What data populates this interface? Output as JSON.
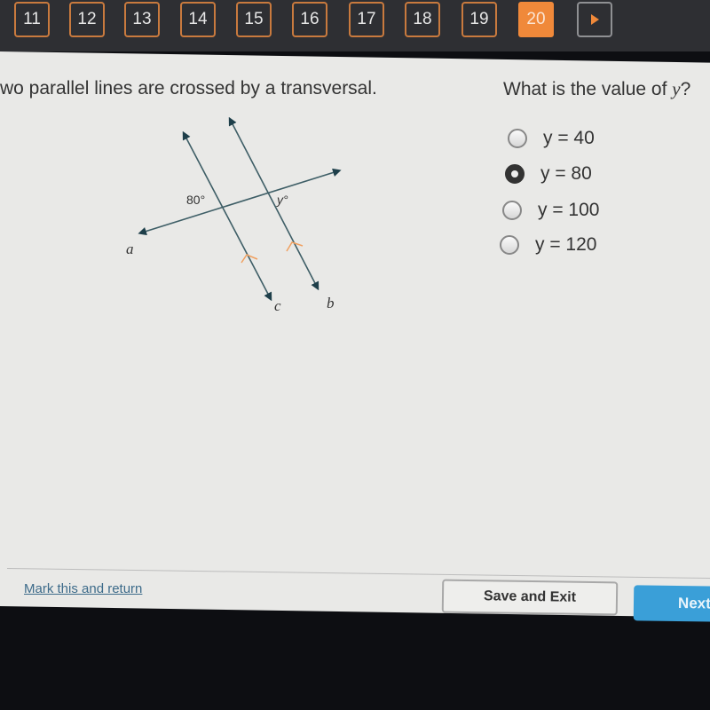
{
  "nav": {
    "questions": [
      {
        "label": "11",
        "active": false
      },
      {
        "label": "12",
        "active": false
      },
      {
        "label": "13",
        "active": false
      },
      {
        "label": "14",
        "active": false
      },
      {
        "label": "15",
        "active": false
      },
      {
        "label": "16",
        "active": false
      },
      {
        "label": "17",
        "active": false
      },
      {
        "label": "18",
        "active": false
      },
      {
        "label": "19",
        "active": false
      },
      {
        "label": "20",
        "active": true
      }
    ],
    "next_icon": "play-triangle-icon",
    "accent_color": "#f0893a"
  },
  "prompt": "wo parallel lines are crossed by a transversal.",
  "question": "What is the value of y?",
  "diagram": {
    "angle_label_known": "80°",
    "angle_label_unknown": "y°",
    "line_labels": [
      "a",
      "c",
      "b"
    ],
    "parallel_marker_color": "#f0a060"
  },
  "options": [
    {
      "label": "y = 40",
      "selected": false
    },
    {
      "label": "y = 80",
      "selected": true
    },
    {
      "label": "y = 100",
      "selected": false
    },
    {
      "label": "y = 120",
      "selected": false
    }
  ],
  "footer": {
    "mark_link": "Mark this and return",
    "save_exit": "Save and Exit",
    "next": "Next"
  }
}
